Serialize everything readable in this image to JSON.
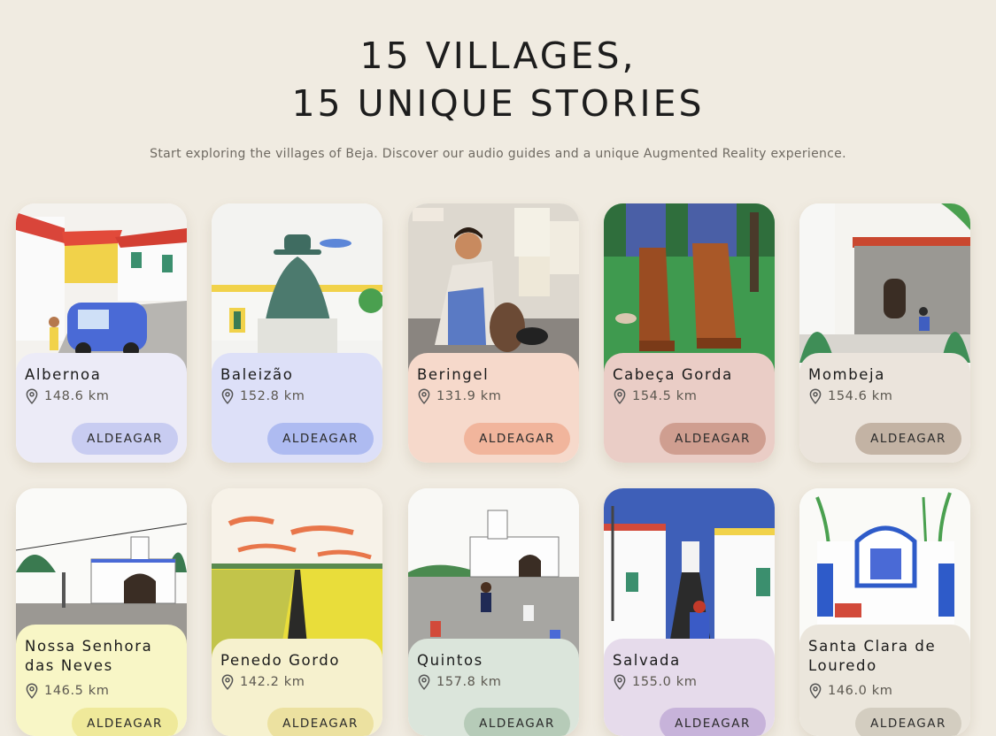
{
  "header": {
    "title_line1": "15 VILLAGES,",
    "title_line2": "15 UNIQUE STORIES",
    "subtitle": "Start exploring the villages of Beja. Discover our audio guides and a unique Augmented Reality experience."
  },
  "cards": [
    {
      "name": "Albernoa",
      "distance": "148.6 km",
      "button": "ALDEAGAR",
      "panel_color": "#ecebf7",
      "button_color": "#c8ccf1"
    },
    {
      "name": "Baleizão",
      "distance": "152.8 km",
      "button": "ALDEAGAR",
      "panel_color": "#dde0f8",
      "button_color": "#aebbf1"
    },
    {
      "name": "Beringel",
      "distance": "131.9 km",
      "button": "ALDEAGAR",
      "panel_color": "#f6d9cb",
      "button_color": "#f1b59c"
    },
    {
      "name": "Cabeça Gorda",
      "distance": "154.5 km",
      "button": "ALDEAGAR",
      "panel_color": "#eacdc6",
      "button_color": "#cf9e90"
    },
    {
      "name": "Mombeja",
      "distance": "154.6 km",
      "button": "ALDEAGAR",
      "panel_color": "#ebe4dc",
      "button_color": "#c3b3a4"
    },
    {
      "name": "Nossa Senhora das Neves",
      "distance": "146.5 km",
      "button": "ALDEAGAR",
      "panel_color": "#f8f6c6",
      "button_color": "#efe99a"
    },
    {
      "name": "Penedo Gordo",
      "distance": "142.2 km",
      "button": "ALDEAGAR",
      "panel_color": "#f6f1ce",
      "button_color": "#ece1a0"
    },
    {
      "name": "Quintos",
      "distance": "157.8 km",
      "button": "ALDEAGAR",
      "panel_color": "#dbe5db",
      "button_color": "#b6cbb8"
    },
    {
      "name": "Salvada",
      "distance": "155.0 km",
      "button": "ALDEAGAR",
      "panel_color": "#e6dbeb",
      "button_color": "#c7b3da"
    },
    {
      "name": "Santa Clara de Louredo",
      "distance": "146.0 km",
      "button": "ALDEAGAR",
      "panel_color": "#ebe6dc",
      "button_color": "#d3cdc0"
    }
  ]
}
